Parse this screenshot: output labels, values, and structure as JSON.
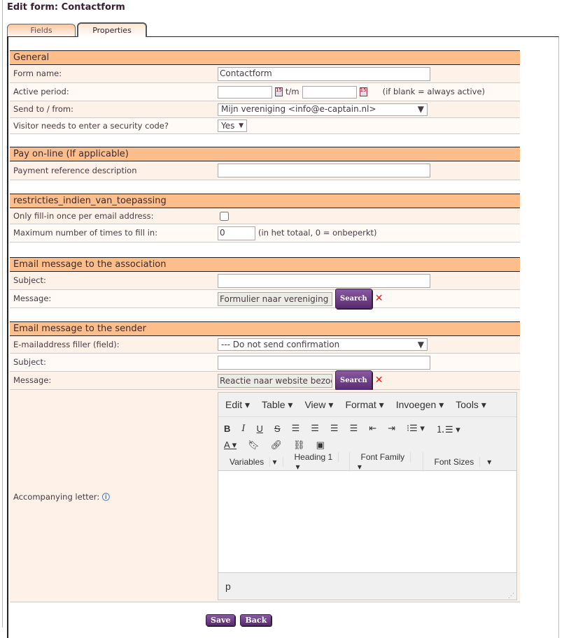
{
  "title": "Edit form: Contactform",
  "tabs": [
    {
      "label": "Fields"
    },
    {
      "label": "Properties"
    }
  ],
  "general": {
    "header": "General",
    "form_name_label": "Form name:",
    "form_name_value": "Contactform",
    "active_period_label": "Active period:",
    "tm": "t/m",
    "active_hint": "(if blank = always active)",
    "send_label": "Send to / from:",
    "send_value": "Mijn vereniging <info@e-captain.nl>",
    "security_label": "Visitor needs to enter a security code?",
    "security_value": "Yes"
  },
  "pay": {
    "header": "Pay on-line (If applicable)",
    "ref_label": "Payment reference description"
  },
  "restrictions": {
    "header": "restricties_indien_van_toepassing",
    "once_label": "Only fill-in once per email address:",
    "once_checked": false,
    "max_label": "Maximum number of times to fill in:",
    "max_value": "0",
    "max_hint": "(in het totaal, 0 = onbeperkt)"
  },
  "assoc": {
    "header": "Email message to the association",
    "subject_label": "Subject:",
    "message_label": "Message:",
    "message_value": "Formulier naar vereniging"
  },
  "sender": {
    "header": "Email message to the sender",
    "filler_label": "E-mailaddress filler (field):",
    "filler_value": "--- Do not send confirmation",
    "subject_label": "Subject:",
    "message_label": "Message:",
    "message_value": "Reactie naar website bezoeker",
    "letter_label": "Accompanying letter:"
  },
  "search_label": "Search",
  "editor": {
    "menus": [
      "Edit",
      "Table",
      "View",
      "Format",
      "Invoegen",
      "Tools"
    ],
    "variables": "Variables",
    "heading": "Heading 1",
    "font_family": "Font Family",
    "font_sizes": "Font Sizes",
    "status": "p"
  },
  "footer": {
    "save": "Save",
    "back": "Back"
  }
}
